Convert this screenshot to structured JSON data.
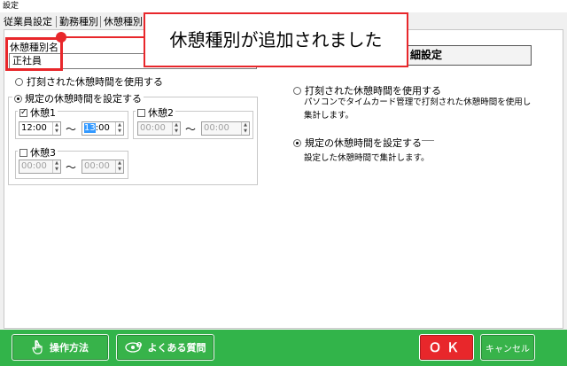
{
  "window": {
    "title": "設定"
  },
  "tabs": [
    {
      "label": "従業員設定"
    },
    {
      "label": "勤務種別"
    },
    {
      "label": "休憩種別"
    }
  ],
  "break_type": {
    "name_label": "休憩種別名",
    "name_value": "正社員"
  },
  "callout": {
    "text": "休憩種別が追加されました"
  },
  "left": {
    "option_stamped": "打刻された休憩時間を使用する",
    "option_fixed": "規定の休憩時間を設定する",
    "break1": {
      "label": "休憩1",
      "checked": true,
      "start": "12:00",
      "end_hour": "13",
      "end_min": ":00"
    },
    "break2": {
      "label": "休憩2",
      "checked": false,
      "start": "00:00",
      "end": "00:00"
    },
    "break3": {
      "label": "休憩3",
      "checked": false,
      "start": "00:00",
      "end": "00:00"
    },
    "tilde": "〜"
  },
  "right": {
    "settings_button": "細設定",
    "option_stamped": "打刻された休憩時間を使用する",
    "desc_stamped_1": "パソコンでタイムカード管理で打刻された休憩時間を使用し",
    "desc_stamped_2": "集計します。",
    "option_fixed": "規定の休憩時間を設定する",
    "desc_fixed": "設定した休憩時間で集計します。"
  },
  "footer": {
    "manual_label": "操作方法",
    "faq_label": "よくある質問",
    "ok_label": "ＯＫ",
    "cancel_label": "キャンセル",
    "icons": [
      "hand-pointer-icon",
      "eye-question-icon"
    ]
  },
  "colors": {
    "accent_red": "#e8272b",
    "footer_green": "#32b44a",
    "selection_blue": "#3399ff"
  }
}
